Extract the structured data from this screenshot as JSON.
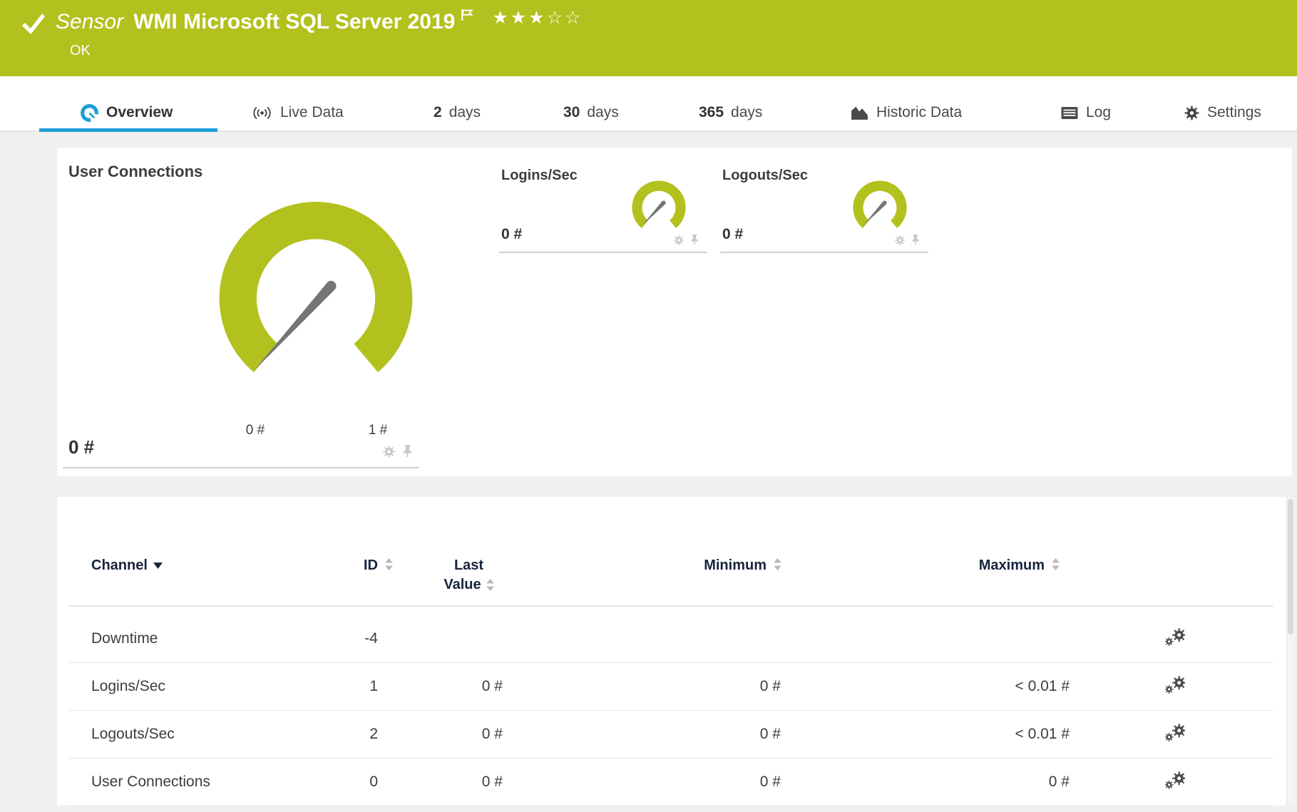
{
  "header": {
    "kind": "Sensor",
    "title": "WMI Microsoft SQL Server 2019",
    "status": "OK",
    "stars_filled": "★★★",
    "stars_empty": "☆☆"
  },
  "tabs": {
    "overview": "Overview",
    "live_data": "Live Data",
    "d2_num": "2",
    "d2_label": "days",
    "d30_num": "30",
    "d30_label": "days",
    "d365_num": "365",
    "d365_label": "days",
    "historic": "Historic Data",
    "log": "Log",
    "settings": "Settings"
  },
  "overview_panel": {
    "primary": {
      "title": "User Connections",
      "value": "0 #",
      "scale_min": "0 #",
      "scale_max": "1 #"
    },
    "logins": {
      "title": "Logins/Sec",
      "value": "0 #"
    },
    "logouts": {
      "title": "Logouts/Sec",
      "value": "0 #"
    }
  },
  "channel_table": {
    "header": {
      "channel": "Channel",
      "id": "ID",
      "last_line1": "Last",
      "last_line2": "Value",
      "minimum": "Minimum",
      "maximum": "Maximum"
    },
    "rows": [
      {
        "channel": "Downtime",
        "id": "-4",
        "last": "",
        "min": "",
        "max": ""
      },
      {
        "channel": "Logins/Sec",
        "id": "1",
        "last": "0 #",
        "min": "0 #",
        "max": "< 0.01 #"
      },
      {
        "channel": "Logouts/Sec",
        "id": "2",
        "last": "0 #",
        "min": "0 #",
        "max": "< 0.01 #"
      },
      {
        "channel": "User Connections",
        "id": "0",
        "last": "0 #",
        "min": "0 #",
        "max": "0 #"
      }
    ]
  },
  "colors": {
    "brand_green": "#b2c11d",
    "accent_blue": "#1f9ed6",
    "header_navy": "#16243c",
    "needle_gray": "#757575",
    "icon_gray": "#c8c8c8"
  }
}
